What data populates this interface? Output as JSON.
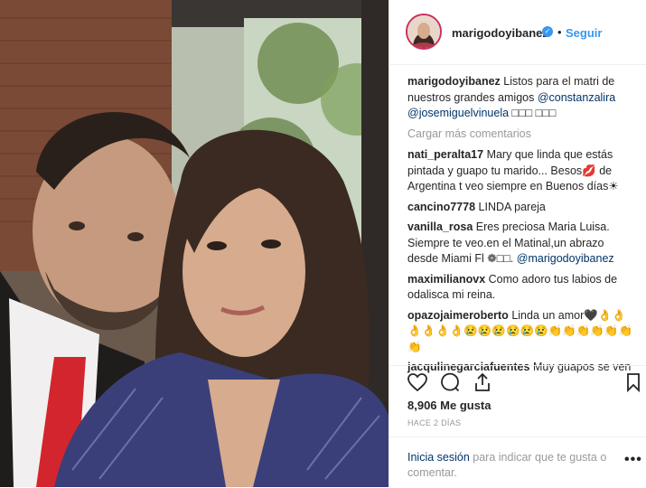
{
  "post": {
    "username": "marigodoyibanez",
    "follow_label": "Seguir",
    "dot": "•",
    "verified_icon": "verified-check-icon"
  },
  "caption": {
    "username": "marigodoyibanez",
    "text": "Listos para el matri de nuestros grandes amigos",
    "mention1": "@constanzalira",
    "mention2": "@josemiguelvinuela",
    "suffix": "□□□ □□□"
  },
  "load_more": "Cargar más comentarios",
  "comments": [
    {
      "user": "nati_peralta17",
      "text": "Mary que linda que estás pintada y guapo tu marido... Besos💋 de Argentina t veo siempre en Buenos días☀"
    },
    {
      "user": "cancino7778",
      "text": "LINDA pareja"
    },
    {
      "user": "vanilla_rosa",
      "text": "Eres preciosa Maria Luisa. Siempre te veo.en el Matinal,un abrazo desde Miami Fl ❁□□.",
      "mention": "@marigodoyibanez"
    },
    {
      "user": "maximilianovx",
      "text": "Como adoro tus labios de odalisca mi reina."
    },
    {
      "user": "opazojaimeroberto",
      "text": "Linda un amor🖤👌👌 👌👌👌👌😢😢😢😢😢😢👏👏👏👏👏👏 👏"
    },
    {
      "user": "jacqulinegarciafuentes",
      "text": "Muy guapos se ven"
    }
  ],
  "stats": {
    "likes": "8,906 Me gusta",
    "time": "HACE 2 DÍAS"
  },
  "login": {
    "link": "Inicia sesión",
    "text": " para indicar que te gusta o comentar.",
    "more": "•••"
  },
  "colors": {
    "link_blue": "#3897f0",
    "mention_blue": "#003569",
    "muted": "#999999"
  }
}
